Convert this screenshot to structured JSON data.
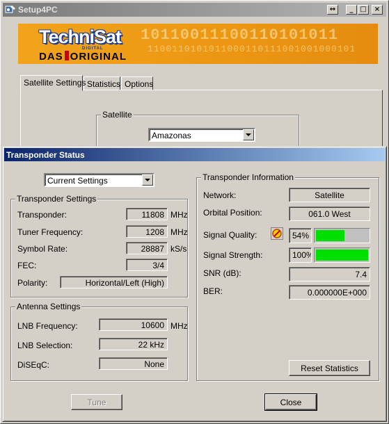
{
  "back_window": {
    "title": "Setup4PC",
    "controls": {
      "restore": "↔",
      "minimize": "_",
      "maximize": "□",
      "close": "×"
    },
    "banner": {
      "brand": "TechniSat",
      "brand_sub": "DIGITAL",
      "slogan_left": "DAS",
      "slogan_right": "ORIGINAL",
      "binary_top": "10110011100110101011",
      "binary_bottom": "1100110101011000110111001001000101"
    },
    "tabs": [
      {
        "label": "Satellite Settings"
      },
      {
        "label": "Statistics"
      },
      {
        "label": "Options"
      }
    ],
    "satellite_group": {
      "label": "Satellite",
      "selected": "Amazonas"
    }
  },
  "dialog": {
    "title": "Transponder Status",
    "mode_select": "Current Settings",
    "transponder_settings": {
      "label": "Transponder Settings",
      "transponder": {
        "label": "Transponder:",
        "value": "11808",
        "unit": "MHz"
      },
      "tuner_frequency": {
        "label": "Tuner Frequency:",
        "value": "1208",
        "unit": "MHz"
      },
      "symbol_rate": {
        "label": "Symbol Rate:",
        "value": "28887",
        "unit": "kS/s"
      },
      "fec": {
        "label": "FEC:",
        "value": "3/4"
      },
      "polarity": {
        "label": "Polarity:",
        "value": "Horizontal/Left (High)"
      }
    },
    "antenna_settings": {
      "label": "Antenna Settings",
      "lnb_frequency": {
        "label": "LNB Frequency:",
        "value": "10600",
        "unit": "MHz"
      },
      "lnb_selection": {
        "label": "LNB Selection:",
        "value": "22 kHz"
      },
      "diseqc": {
        "label": "DiSEqC:",
        "value": "None"
      }
    },
    "transponder_information": {
      "label": "Transponder Information",
      "network": {
        "label": "Network:",
        "value": "Satellite"
      },
      "orbital_position": {
        "label": "Orbital Position:",
        "value": "061.0 West"
      },
      "signal_quality": {
        "label": "Signal Quality:",
        "value": "54%",
        "level": 0.54,
        "color": "#00e000"
      },
      "signal_strength": {
        "label": "Signal Strength:",
        "value": "100%",
        "level": 1.0,
        "color": "#00e000"
      },
      "snr": {
        "label": "SNR (dB):",
        "value": "7.4"
      },
      "ber": {
        "label": "BER:",
        "value": "0.000000E+000"
      }
    },
    "buttons": {
      "reset_statistics": "Reset Statistics",
      "tune": "Tune",
      "close": "Close"
    }
  }
}
